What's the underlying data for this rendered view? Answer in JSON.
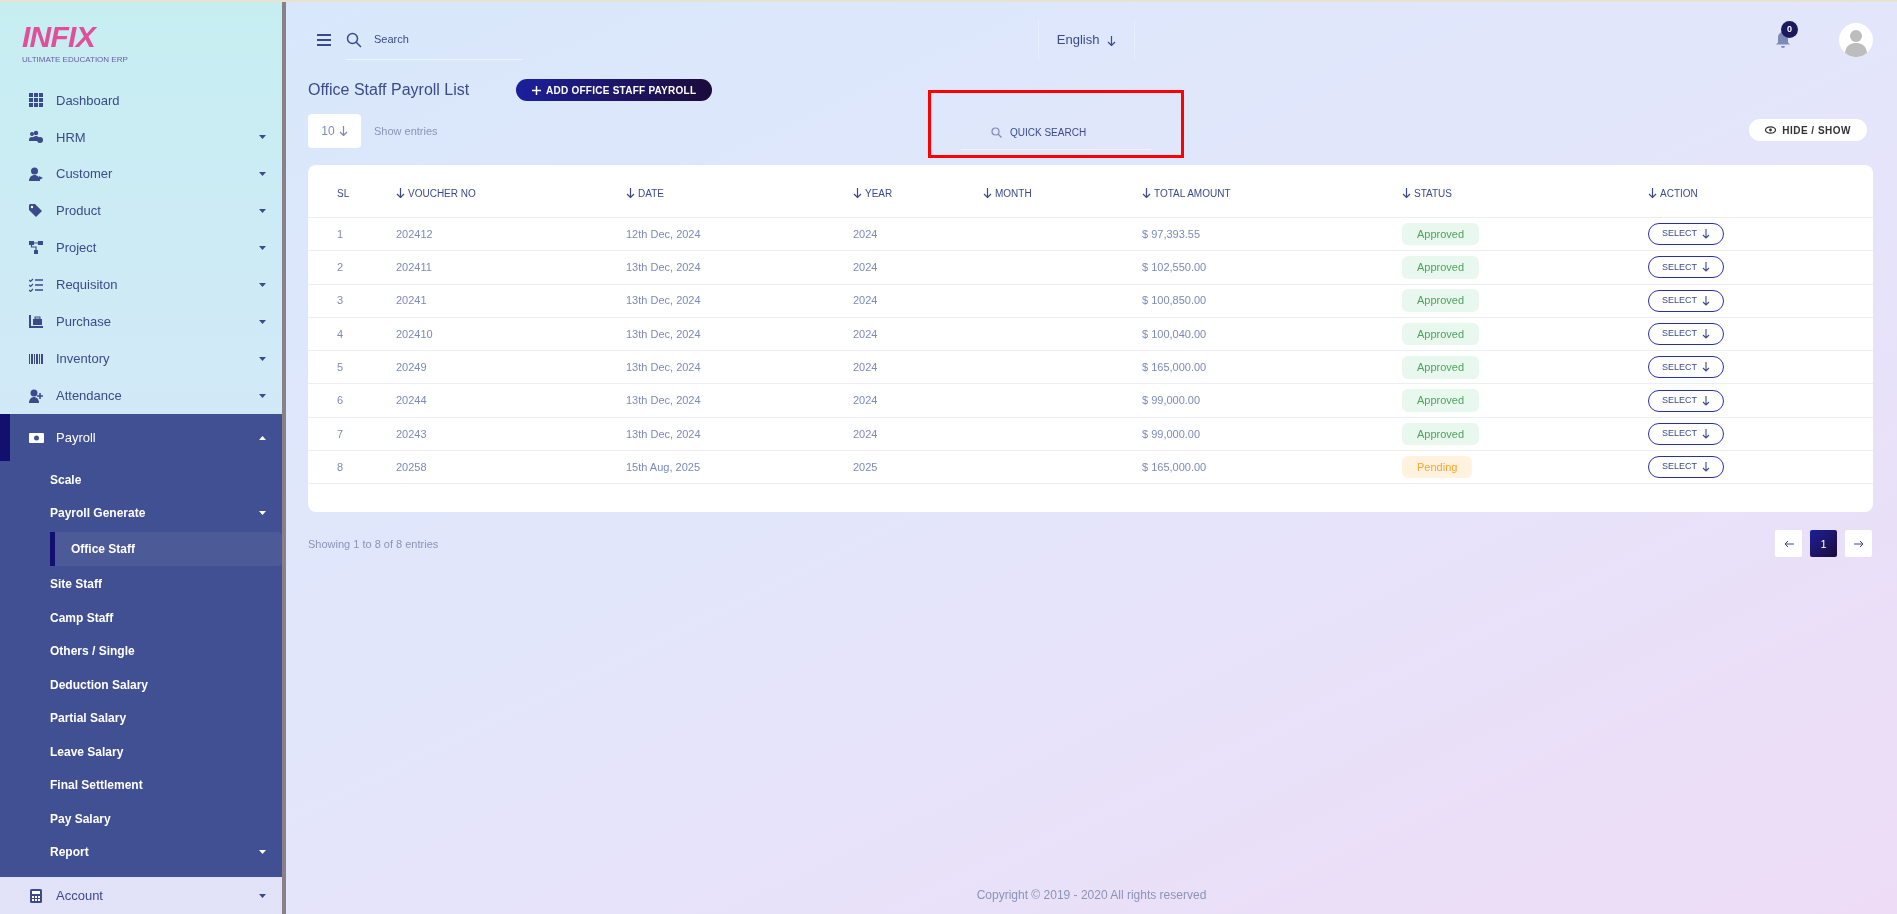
{
  "logo": {
    "name": "INFIX",
    "tagline": "ULTIMATE EDUCATION ERP"
  },
  "sidebar": {
    "items": [
      {
        "label": "Dashboard",
        "has_submenu": false,
        "expanded": false,
        "selected": false
      },
      {
        "label": "HRM",
        "has_submenu": true,
        "expanded": false,
        "selected": false
      },
      {
        "label": "Customer",
        "has_submenu": true,
        "expanded": false,
        "selected": false
      },
      {
        "label": "Product",
        "has_submenu": true,
        "expanded": false,
        "selected": false
      },
      {
        "label": "Project",
        "has_submenu": true,
        "expanded": false,
        "selected": false
      },
      {
        "label": "Requisiton",
        "has_submenu": true,
        "expanded": false,
        "selected": false
      },
      {
        "label": "Purchase",
        "has_submenu": true,
        "expanded": false,
        "selected": false
      },
      {
        "label": "Inventory",
        "has_submenu": true,
        "expanded": false,
        "selected": false
      },
      {
        "label": "Attendance",
        "has_submenu": true,
        "expanded": false,
        "selected": false
      },
      {
        "label": "Payroll",
        "has_submenu": true,
        "expanded": true,
        "selected": false,
        "children": [
          {
            "label": "Scale",
            "has_submenu": false,
            "selected": false
          },
          {
            "label": "Payroll Generate",
            "has_submenu": true,
            "selected": false,
            "children": [
              {
                "label": "Office Staff",
                "has_submenu": false,
                "selected": true
              }
            ]
          },
          {
            "label": "Site Staff",
            "has_submenu": false,
            "selected": false
          },
          {
            "label": "Camp Staff",
            "has_submenu": false,
            "selected": false
          },
          {
            "label": "Others / Single",
            "has_submenu": false,
            "selected": false
          },
          {
            "label": "Deduction Salary",
            "has_submenu": false,
            "selected": false
          },
          {
            "label": "Partial Salary",
            "has_submenu": false,
            "selected": false
          },
          {
            "label": "Leave Salary",
            "has_submenu": false,
            "selected": false
          },
          {
            "label": "Final Settlement",
            "has_submenu": false,
            "selected": false
          },
          {
            "label": "Pay Salary",
            "has_submenu": false,
            "selected": false
          },
          {
            "label": "Report",
            "has_submenu": true,
            "selected": false
          }
        ]
      },
      {
        "label": "Account",
        "has_submenu": true,
        "expanded": false,
        "selected": false
      }
    ]
  },
  "top_bar": {
    "search": {
      "placeholder": "Search"
    },
    "language": "English",
    "notifications": "0"
  },
  "page": {
    "title": "Office Staff Payroll List",
    "add_button": "ADD OFFICE STAFF PAYROLL",
    "entries": {
      "value": "10",
      "label": "Show entries"
    },
    "quick_search": {
      "placeholder": "QUICK SEARCH",
      "highlighted": true
    },
    "hide_show_button": "HIDE / SHOW"
  },
  "table": {
    "columns": [
      {
        "label": "SL",
        "sortable": false
      },
      {
        "label": "VOUCHER NO",
        "sortable": true
      },
      {
        "label": "DATE",
        "sortable": true
      },
      {
        "label": "YEAR",
        "sortable": true
      },
      {
        "label": "MONTH",
        "sortable": true
      },
      {
        "label": "TOTAL AMOUNT",
        "sortable": true
      },
      {
        "label": "STATUS",
        "sortable": true
      },
      {
        "label": "ACTION",
        "sortable": true
      }
    ],
    "rows": [
      {
        "sl": "1",
        "voucher_no": "202412",
        "date": "12th Dec, 2024",
        "year": "2024",
        "amount": "$ 97,393.55",
        "status": {
          "label": "Approved",
          "kind": "approved"
        },
        "action": "SELECT"
      },
      {
        "sl": "2",
        "voucher_no": "202411",
        "date": "13th Dec, 2024",
        "year": "2024",
        "amount": "$ 102,550.00",
        "status": {
          "label": "Approved",
          "kind": "approved"
        },
        "action": "SELECT"
      },
      {
        "sl": "3",
        "voucher_no": "20241",
        "date": "13th Dec, 2024",
        "year": "2024",
        "amount": "$ 100,850.00",
        "status": {
          "label": "Approved",
          "kind": "approved"
        },
        "action": "SELECT"
      },
      {
        "sl": "4",
        "voucher_no": "202410",
        "date": "13th Dec, 2024",
        "year": "2024",
        "amount": "$ 100,040.00",
        "status": {
          "label": "Approved",
          "kind": "approved"
        },
        "action": "SELECT"
      },
      {
        "sl": "5",
        "voucher_no": "20249",
        "date": "13th Dec, 2024",
        "year": "2024",
        "amount": "$ 165,000.00",
        "status": {
          "label": "Approved",
          "kind": "approved"
        },
        "action": "SELECT"
      },
      {
        "sl": "6",
        "voucher_no": "20244",
        "date": "13th Dec, 2024",
        "year": "2024",
        "amount": "$ 99,000.00",
        "status": {
          "label": "Approved",
          "kind": "approved"
        },
        "action": "SELECT"
      },
      {
        "sl": "7",
        "voucher_no": "20243",
        "date": "13th Dec, 2024",
        "year": "2024",
        "amount": "$ 99,000.00",
        "status": {
          "label": "Approved",
          "kind": "approved"
        },
        "action": "SELECT"
      },
      {
        "sl": "8",
        "voucher_no": "20258",
        "date": "15th Aug, 2025",
        "year": "2025",
        "amount": "$ 165,000.00",
        "status": {
          "label": "Pending",
          "kind": "pending"
        },
        "action": "SELECT"
      }
    ]
  },
  "footer": {
    "showing": "Showing 1 to 8 of 8 entries",
    "pages": [
      {
        "label": "1",
        "selected": true
      }
    ],
    "copyright": "Copyright © 2019 - 2020 All rights reserved"
  }
}
